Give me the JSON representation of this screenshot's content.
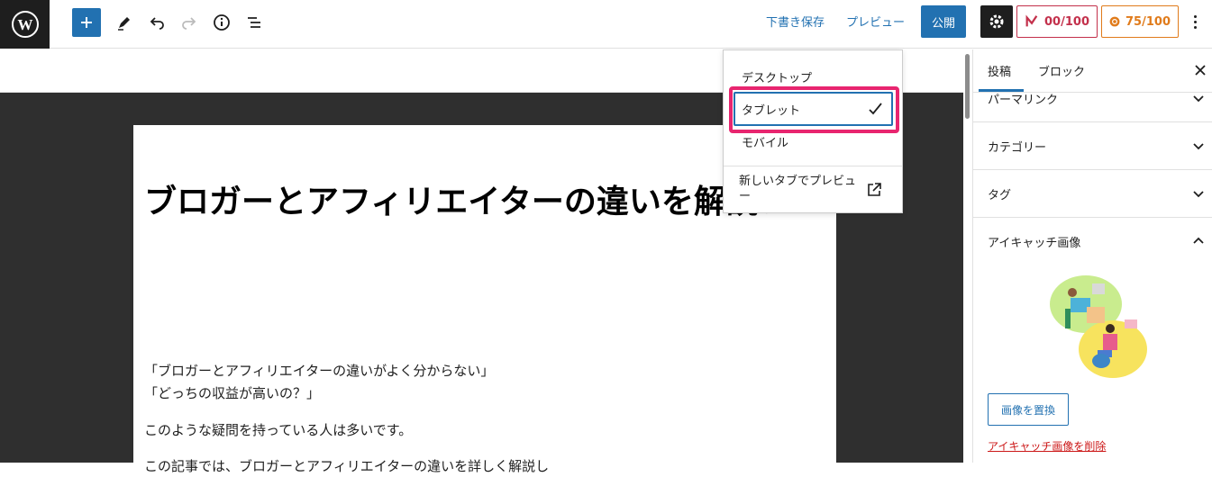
{
  "toolbar": {
    "draft_label": "下書き保存",
    "preview_label": "プレビュー",
    "publish_label": "公開",
    "yoast_score": "00/100",
    "rankmath_score": "75/100"
  },
  "preview_menu": {
    "items": [
      "デスクトップ",
      "タブレット",
      "モバイル"
    ],
    "selected": "タブレット",
    "new_tab_label": "新しいタブでプレビュー"
  },
  "post": {
    "title": "ブロガーとアフィリエイターの違いを解説！",
    "quote_lines": [
      "「ブロガーとアフィリエイターの違いがよく分からない」",
      "「どっちの収益が高いの？」"
    ],
    "paragraph": "このような疑問を持っている人は多いです。",
    "paragraph_cut": "この記事では、ブロガーとアフィリエイターの違いを詳しく解説し"
  },
  "sidebar": {
    "tabs": [
      "投稿",
      "ブロック"
    ],
    "panels": [
      "パーマリンク",
      "カテゴリー",
      "タグ",
      "アイキャッチ画像"
    ],
    "replace_image_label": "画像を置換",
    "remove_image_label": "アイキャッチ画像を削除"
  },
  "colors": {
    "accent": "#2271b1",
    "highlight": "#e8256f",
    "yoast": "#c3304b",
    "rankmath": "#e07b1b"
  }
}
